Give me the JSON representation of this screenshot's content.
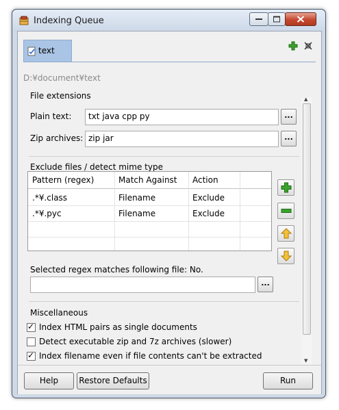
{
  "window": {
    "title": "Indexing Queue"
  },
  "tabs": [
    {
      "label": "text",
      "checked": true
    }
  ],
  "toolbar": {
    "add_icon": "green-plus-icon",
    "remove_icon": "remove-tab-icon"
  },
  "path": "D:¥document¥text",
  "file_extensions": {
    "title": "File extensions",
    "plain_text_label": "Plain text:",
    "plain_text_value": "txt java cpp py",
    "zip_label": "Zip archives:",
    "zip_value": "zip jar",
    "browse_label": "..."
  },
  "exclude": {
    "title": "Exclude files / detect mime type",
    "columns": [
      "Pattern (regex)",
      "Match Against",
      "Action"
    ],
    "rows": [
      [
        ".*¥.class",
        "Filename",
        "Exclude"
      ],
      [
        ".*¥.pyc",
        "Filename",
        "Exclude"
      ]
    ],
    "side_buttons": [
      "add-icon",
      "remove-icon",
      "move-up-icon",
      "move-down-icon"
    ],
    "regex_label": "Selected regex matches following file: No.",
    "regex_field_value": "",
    "browse_label": "..."
  },
  "misc": {
    "title": "Miscellaneous",
    "options": [
      {
        "label": "Index HTML pairs as single documents",
        "checked": true
      },
      {
        "label": "Detect executable zip and 7z archives (slower)",
        "checked": false
      },
      {
        "label": "Index filename even if file contents can't be extracted",
        "checked": true
      }
    ]
  },
  "buttons": {
    "help": "Help",
    "restore": "Restore Defaults",
    "run": "Run"
  },
  "colors": {
    "accent": "#a9c4e4",
    "add_green": "#3aa32b",
    "arrow_orange": "#e8a21c"
  }
}
